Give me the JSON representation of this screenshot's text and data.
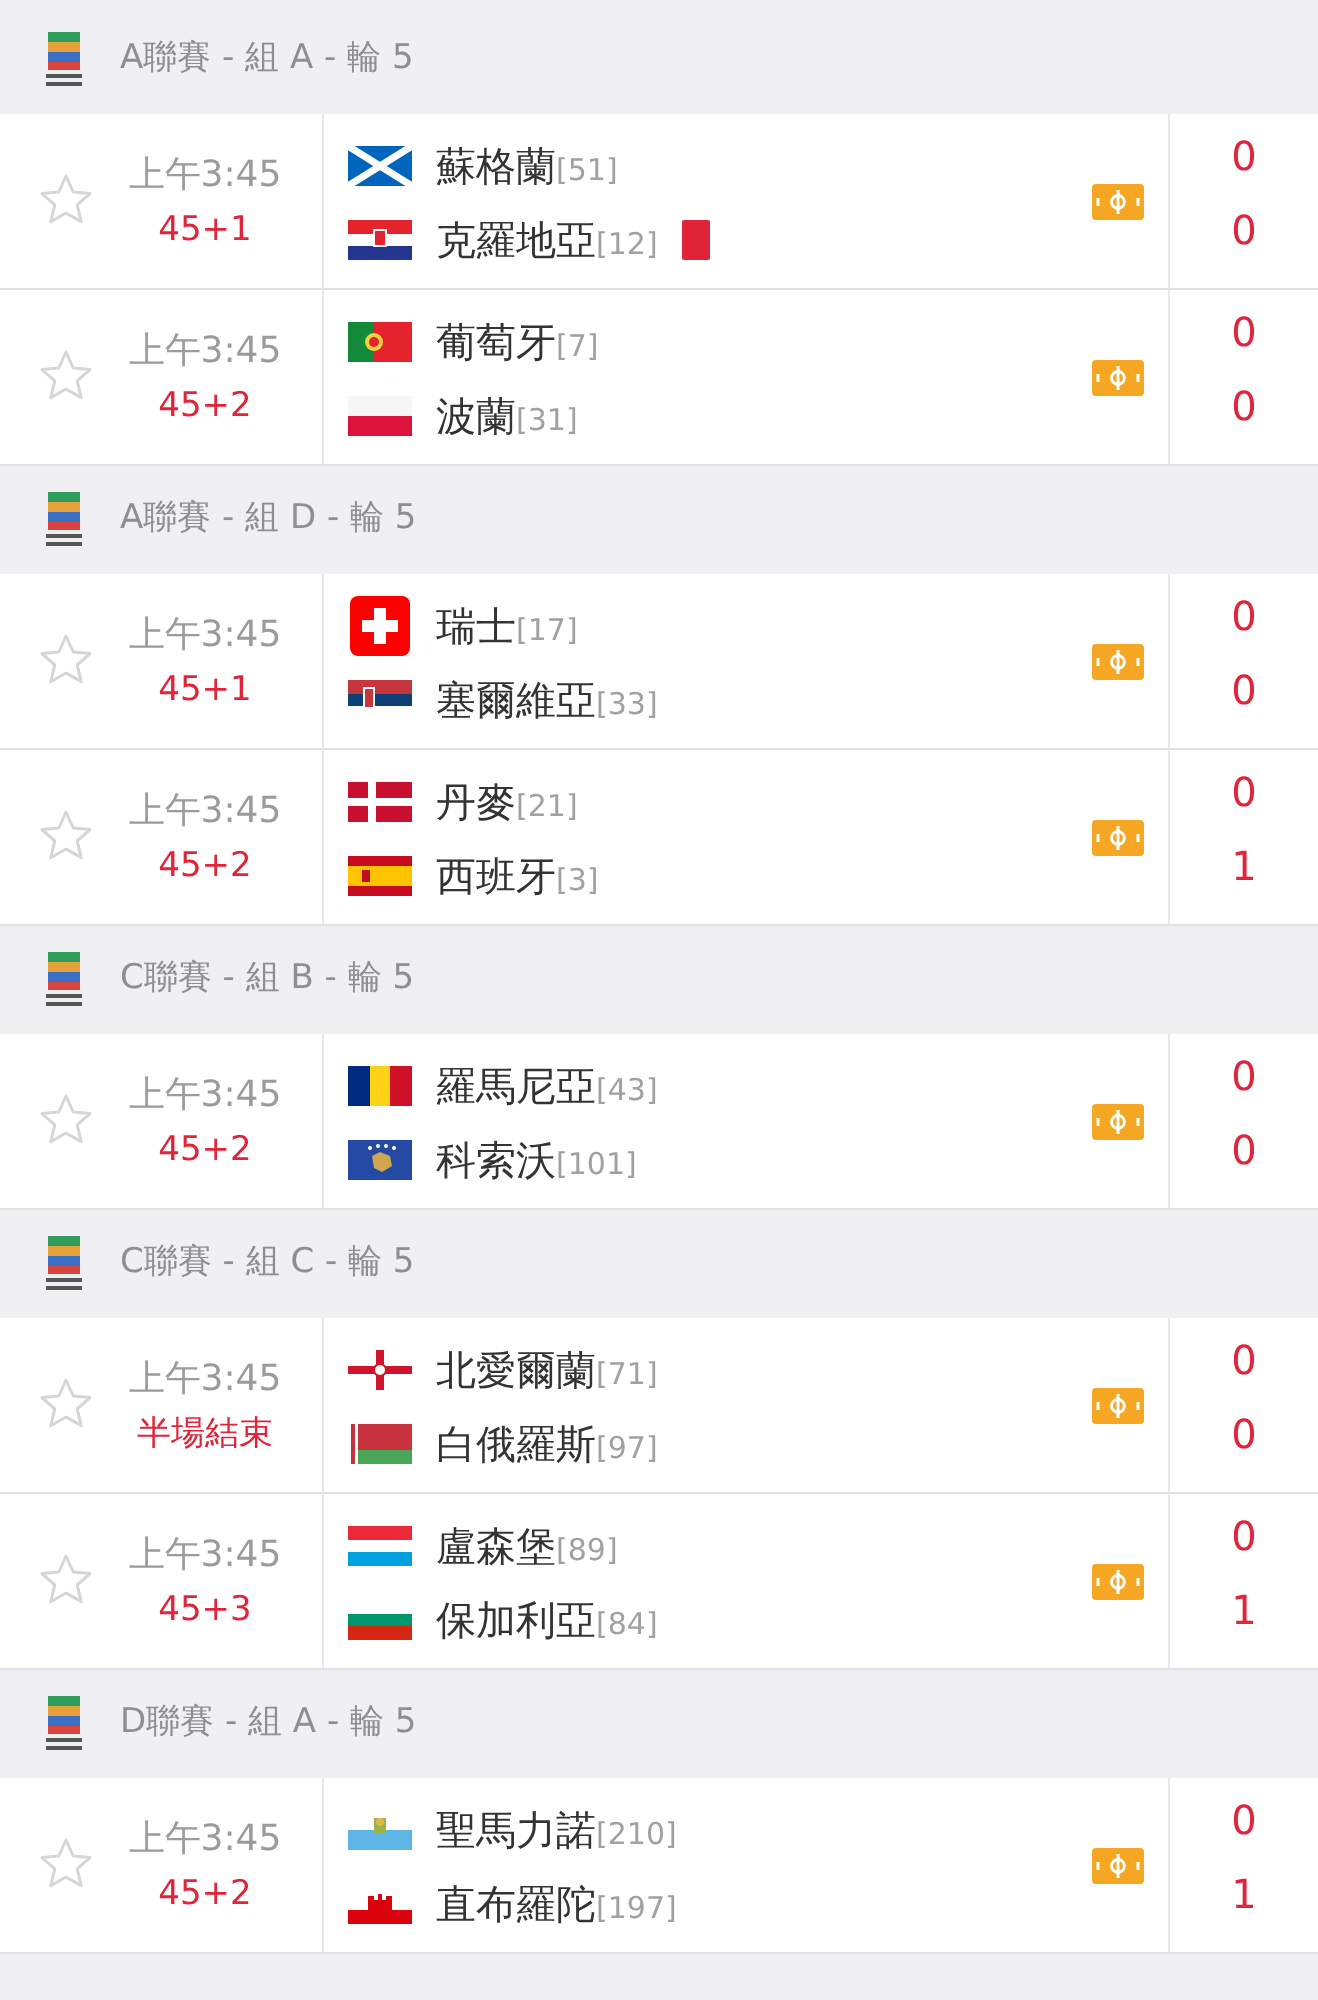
{
  "sections": [
    {
      "title": "A聯賽 - 組 A - 輪 5",
      "matches": [
        {
          "favorite": false,
          "time": "上午3:45",
          "status": "45+1",
          "live": true,
          "teams": [
            {
              "kind": "sco",
              "name": "蘇格蘭",
              "rank": "[51]",
              "red_card": false,
              "score": "0"
            },
            {
              "kind": "cro",
              "name": "克羅地亞",
              "rank": "[12]",
              "red_card": true,
              "score": "0"
            }
          ]
        },
        {
          "favorite": false,
          "time": "上午3:45",
          "status": "45+2",
          "live": true,
          "teams": [
            {
              "kind": "por",
              "name": "葡萄牙",
              "rank": "[7]",
              "red_card": false,
              "score": "0"
            },
            {
              "kind": "pol",
              "name": "波蘭",
              "rank": "[31]",
              "red_card": false,
              "score": "0"
            }
          ]
        }
      ]
    },
    {
      "title": "A聯賽 - 組 D - 輪 5",
      "matches": [
        {
          "favorite": false,
          "time": "上午3:45",
          "status": "45+1",
          "live": true,
          "teams": [
            {
              "kind": "sui",
              "name": "瑞士",
              "rank": "[17]",
              "red_card": false,
              "score": "0"
            },
            {
              "kind": "srb",
              "name": "塞爾維亞",
              "rank": "[33]",
              "red_card": false,
              "score": "0"
            }
          ]
        },
        {
          "favorite": false,
          "time": "上午3:45",
          "status": "45+2",
          "live": true,
          "teams": [
            {
              "kind": "den",
              "name": "丹麥",
              "rank": "[21]",
              "red_card": false,
              "score": "0"
            },
            {
              "kind": "esp",
              "name": "西班牙",
              "rank": "[3]",
              "red_card": false,
              "score": "1"
            }
          ]
        }
      ]
    },
    {
      "title": "C聯賽 - 組 B - 輪 5",
      "matches": [
        {
          "favorite": false,
          "time": "上午3:45",
          "status": "45+2",
          "live": true,
          "teams": [
            {
              "kind": "rou",
              "name": "羅馬尼亞",
              "rank": "[43]",
              "red_card": false,
              "score": "0"
            },
            {
              "kind": "kos",
              "name": "科索沃",
              "rank": "[101]",
              "red_card": false,
              "score": "0"
            }
          ]
        }
      ]
    },
    {
      "title": "C聯賽 - 組 C - 輪 5",
      "matches": [
        {
          "favorite": false,
          "time": "上午3:45",
          "status": "半場結束",
          "live": true,
          "teams": [
            {
              "kind": "nir",
              "name": "北愛爾蘭",
              "rank": "[71]",
              "red_card": false,
              "score": "0"
            },
            {
              "kind": "blr",
              "name": "白俄羅斯",
              "rank": "[97]",
              "red_card": false,
              "score": "0"
            }
          ]
        },
        {
          "favorite": false,
          "time": "上午3:45",
          "status": "45+3",
          "live": true,
          "teams": [
            {
              "kind": "lux",
              "name": "盧森堡",
              "rank": "[89]",
              "red_card": false,
              "score": "0"
            },
            {
              "kind": "bul",
              "name": "保加利亞",
              "rank": "[84]",
              "red_card": false,
              "score": "1"
            }
          ]
        }
      ]
    },
    {
      "title": "D聯賽 - 組 A - 輪 5",
      "matches": [
        {
          "favorite": false,
          "time": "上午3:45",
          "status": "45+2",
          "live": true,
          "teams": [
            {
              "kind": "smr",
              "name": "聖馬力諾",
              "rank": "[210]",
              "red_card": false,
              "score": "0"
            },
            {
              "kind": "gib",
              "name": "直布羅陀",
              "rank": "[197]",
              "red_card": false,
              "score": "1"
            }
          ]
        }
      ]
    }
  ]
}
